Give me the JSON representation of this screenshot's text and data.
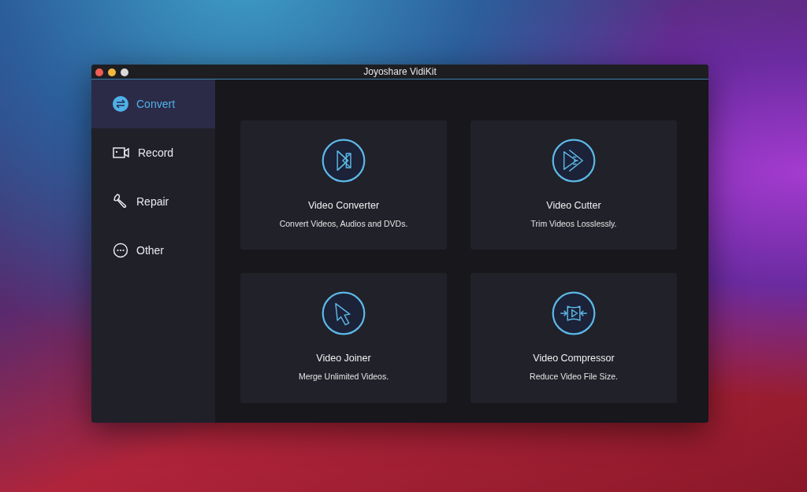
{
  "window": {
    "title": "Joyoshare VidiKit"
  },
  "sidebar": {
    "items": [
      {
        "label": "Convert",
        "kind": "convert",
        "selected": true
      },
      {
        "label": "Record",
        "kind": "record",
        "selected": false
      },
      {
        "label": "Repair",
        "kind": "repair",
        "selected": false
      },
      {
        "label": "Other",
        "kind": "other",
        "selected": false
      }
    ]
  },
  "tools": [
    {
      "title": "Video Converter",
      "description": "Convert Videos, Audios and DVDs.",
      "kind": "converter"
    },
    {
      "title": "Video Cutter",
      "description": "Trim Videos Losslessly.",
      "kind": "cutter"
    },
    {
      "title": "Video Joiner",
      "description": "Merge Unlimited Videos.",
      "kind": "joiner"
    },
    {
      "title": "Video Compressor",
      "description": "Reduce Video File Size.",
      "kind": "compressor"
    }
  ]
}
